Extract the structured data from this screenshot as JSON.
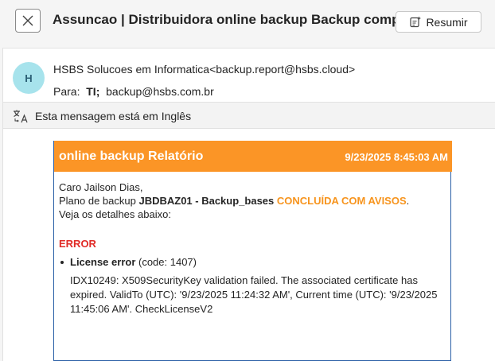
{
  "header": {
    "close_icon": "close-icon",
    "subject": "Assuncao | Distribuidora online backup Backup completed",
    "summarize_label": "Resumir",
    "summarize_icon": "summarize-sparkle-icon"
  },
  "message": {
    "avatar_initial": "H",
    "avatar_color": "#a7e3ec",
    "from": "HSBS Solucoes em Informatica<backup.report@hsbs.cloud>",
    "to_label": "Para:",
    "to_name": "TI;",
    "to_email": "backup@hsbs.com.br"
  },
  "language_bar": {
    "icon": "translate-icon",
    "text": "Esta mensagem está em Inglês"
  },
  "report": {
    "header_color": "#fb9526",
    "border_color": "#2a5fa6",
    "title": "online backup Relatório",
    "datetime": "9/23/2025 8:45:03 AM",
    "greeting": "Caro Jailson Dias,",
    "plan_prefix": "Plano de backup ",
    "plan_name": "JBDBAZ01 - Backup_bases",
    "status": "CONCLUÍDA COM AVISOS",
    "plan_suffix": ".",
    "details_line": "Veja os detalhes abaixo:",
    "error_heading": "ERROR",
    "error_color": "#e02b27",
    "warning_color": "#f7941d",
    "error_title": "License error",
    "error_code": "(code: 1407)",
    "error_detail": "IDX10249: X509SecurityKey validation failed. The associated certificate has expired. ValidTo (UTC): '9/23/2025 11:24:32 AM', Current time (UTC): '9/23/2025 11:45:06 AM'. CheckLicenseV2"
  }
}
